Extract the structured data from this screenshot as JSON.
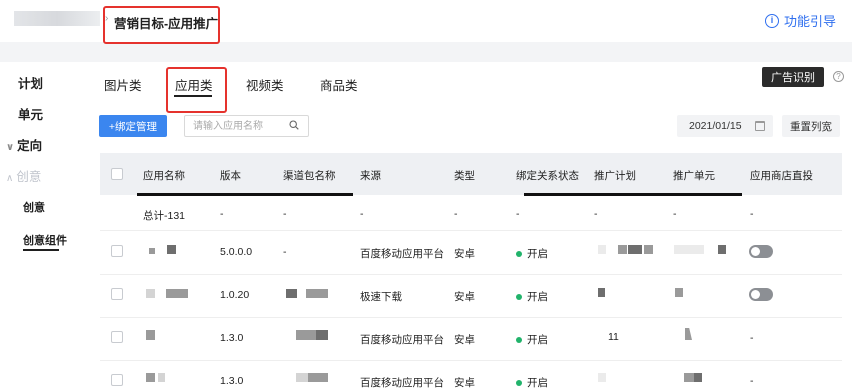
{
  "header": {
    "page_title": "营销目标-应用推广",
    "help_label": "功能引导",
    "help_icon": "info-icon"
  },
  "sidebar": {
    "items": [
      {
        "label": "计划"
      },
      {
        "label": "单元"
      },
      {
        "label": "定向"
      },
      {
        "label": "创意"
      },
      {
        "label": "创意"
      },
      {
        "label": "创意组件"
      }
    ]
  },
  "tabs": [
    {
      "label": "图片类",
      "active": false
    },
    {
      "label": "应用类",
      "active": true
    },
    {
      "label": "视频类",
      "active": false
    },
    {
      "label": "商品类",
      "active": false
    }
  ],
  "toolbar": {
    "ad_recognize_label": "广告识别",
    "bind_label": "+绑定管理",
    "search_placeholder": "请输入应用名称",
    "date_value": "2021/01/15",
    "reset_columns_label": "重置列宽"
  },
  "table": {
    "headers": [
      "应用名称",
      "版本",
      "渠道包名称",
      "来源",
      "类型",
      "绑定关系状态",
      "推广计划",
      "推广单元",
      "应用商店直投"
    ],
    "summary": {
      "name": "总计-131",
      "version": "-",
      "channel": "-",
      "source": "-",
      "type": "-",
      "status": "-",
      "plan": "-",
      "unit": "-",
      "direct": "-"
    },
    "rows": [
      {
        "version": "5.0.0.0",
        "channel": "-",
        "source": "百度移动应用平台",
        "type": "安卓",
        "status": "开启",
        "plan": "",
        "unit": "",
        "direct": "on"
      },
      {
        "version": "1.0.20",
        "channel": "",
        "source": "极速下载",
        "type": "安卓",
        "status": "开启",
        "plan": "",
        "unit": "",
        "direct": "on"
      },
      {
        "version": "1.3.0",
        "channel": "",
        "source": "百度移动应用平台",
        "type": "安卓",
        "status": "开启",
        "plan": "11",
        "unit": "",
        "direct": "-"
      },
      {
        "version": "1.3.0",
        "channel": "",
        "source": "百度移动应用平台",
        "type": "安卓",
        "status": "开启",
        "plan": "",
        "unit": "",
        "direct": "-"
      }
    ]
  },
  "colors": {
    "accent": "#3b86ef",
    "annotation": "#e5322d",
    "status_green": "#21b36b"
  }
}
